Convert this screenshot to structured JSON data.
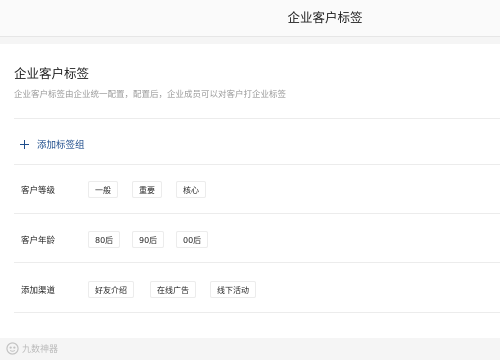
{
  "header": {
    "title": "企业客户标签"
  },
  "panel": {
    "title": "企业客户标签",
    "description": "企业客户标签由企业统一配置，配置后，企业成员可以对客户打企业标签",
    "add_group_label": "添加标签组"
  },
  "tag_groups": [
    {
      "label": "客户等级",
      "tags": [
        "一般",
        "重要",
        "核心"
      ]
    },
    {
      "label": "客户年龄",
      "tags": [
        "80后",
        "90后",
        "00后"
      ]
    },
    {
      "label": "添加渠道",
      "tags": [
        "好友介绍",
        "在线广告",
        "线下活动"
      ]
    }
  ],
  "watermark": {
    "text": "九数神器"
  },
  "colors": {
    "accent": "#1e4d8c",
    "background": "#f5f5f5",
    "panel": "#ffffff"
  }
}
